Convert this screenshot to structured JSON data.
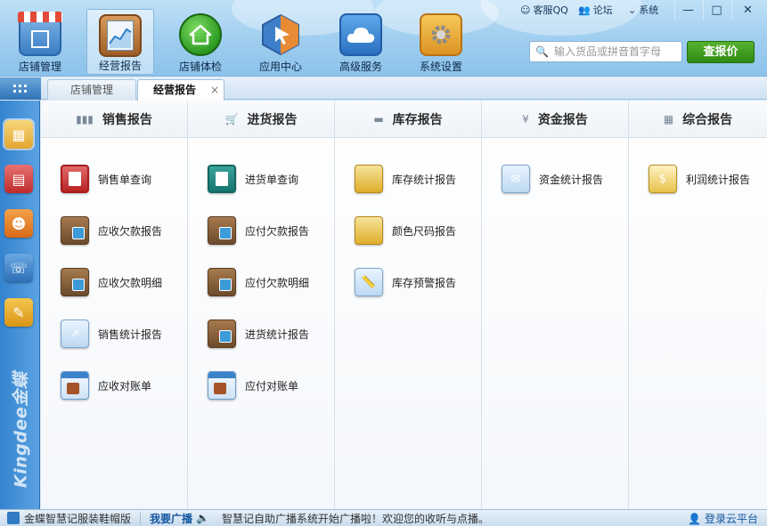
{
  "top_links": {
    "service_qq": "客服QQ",
    "forum": "论坛",
    "system": "系统"
  },
  "window_controls": {
    "minimize": "—",
    "maximize": "□",
    "close": "✕"
  },
  "modules": [
    {
      "label": "店铺管理",
      "icon": "storefront-icon",
      "color": "#4a86c8"
    },
    {
      "label": "经营报告",
      "icon": "report-chart-icon",
      "color": "#c47a3a"
    },
    {
      "label": "店铺体检",
      "icon": "green-home-icon",
      "color": "#2d9a2d"
    },
    {
      "label": "应用中心",
      "icon": "hexagon-arrow-icon",
      "color": "#e27b2b"
    },
    {
      "label": "高级服务",
      "icon": "cloud-icon",
      "color": "#3d8fd6"
    },
    {
      "label": "系统设置",
      "icon": "gear-folder-icon",
      "color": "#e9a03b"
    }
  ],
  "search": {
    "placeholder": "输入货品或拼音首字母",
    "button": "查报价"
  },
  "tabs": [
    {
      "label": "店铺管理",
      "active": false
    },
    {
      "label": "经营报告",
      "active": true,
      "close": "×"
    }
  ],
  "sidebar_brand": "Kingdee金蝶",
  "sidebar_icons": [
    "boxes-icon",
    "calculator-icon",
    "vip-card-icon",
    "phone-icon",
    "notebook-icon"
  ],
  "columns": [
    {
      "title": "销售报告",
      "icon": "bar-chart-icon",
      "items": [
        {
          "label": "销售单查询",
          "icon": "calculator-icon"
        },
        {
          "label": "应收欠款报告",
          "icon": "wallet-icon"
        },
        {
          "label": "应收欠款明细",
          "icon": "wallet-detail-icon"
        },
        {
          "label": "销售统计报告",
          "icon": "line-chart-icon"
        },
        {
          "label": "应收对账单",
          "icon": "calendar-icon"
        }
      ]
    },
    {
      "title": "进货报告",
      "icon": "cart-icon",
      "items": [
        {
          "label": "进货单查询",
          "icon": "calculator-icon"
        },
        {
          "label": "应付欠款报告",
          "icon": "wallet-icon"
        },
        {
          "label": "应付欠款明细",
          "icon": "wallet-detail-icon"
        },
        {
          "label": "进货统计报告",
          "icon": "checklist-icon"
        },
        {
          "label": "应付对账单",
          "icon": "calendar-icon"
        }
      ]
    },
    {
      "title": "库存报告",
      "icon": "folder-icon",
      "items": [
        {
          "label": "库存统计报告",
          "icon": "boxes-icon"
        },
        {
          "label": "颜色尺码报告",
          "icon": "boxes-icon"
        },
        {
          "label": "库存预警报告",
          "icon": "ruler-icon"
        }
      ]
    },
    {
      "title": "资金报告",
      "icon": "yen-icon",
      "items": [
        {
          "label": "资金统计报告",
          "icon": "money-icon"
        }
      ]
    },
    {
      "title": "综合报告",
      "icon": "grid-icon",
      "items": [
        {
          "label": "利润统计报告",
          "icon": "profit-icon"
        }
      ]
    }
  ],
  "status_bar": {
    "app_name": "金蝶智慧记服装鞋帽版",
    "broadcast_label": "我要广播",
    "message": "智慧记自助广播系统开始广播啦！欢迎您的收听与点播。",
    "login": "登录云平台"
  }
}
